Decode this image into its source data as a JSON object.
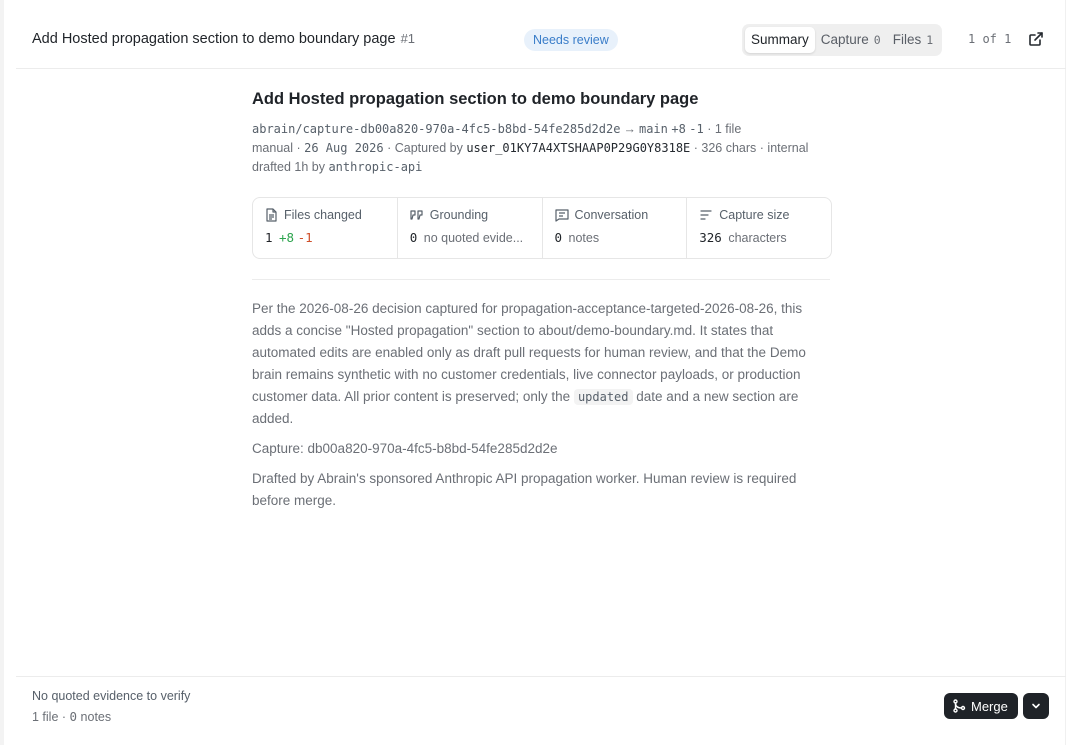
{
  "header": {
    "title": "Add Hosted propagation section to demo boundary page",
    "number": "#1",
    "status": "Needs review",
    "tabs": [
      {
        "label": "Summary",
        "count": ""
      },
      {
        "label": "Capture",
        "count": "0"
      },
      {
        "label": "Files",
        "count": "1"
      }
    ],
    "pager": "1 of 1"
  },
  "main": {
    "title": "Add Hosted propagation section to demo boundary page",
    "branch": "abrain/capture-db00a820-970a-4fc5-b8bd-54fe285d2d2e",
    "arrow": "→",
    "base": "main",
    "additions": "+8",
    "deletions": "-1",
    "files_label": "· 1 file",
    "capture_method": "manual ·",
    "capture_date": "26 Aug 2026",
    "captured_by_label": "· Captured by",
    "captured_by_user": "user_01KY7A4XTSHAAP0P29G0Y8318E",
    "chars_label": "· 326 chars ·",
    "visibility": "internal",
    "drafted_prefix": "drafted 1h by",
    "drafted_by": "anthropic-api"
  },
  "cards": {
    "files": {
      "label": "Files changed",
      "count": "1",
      "additions": "+8",
      "deletions": "-1"
    },
    "grounding": {
      "label": "Grounding",
      "count": "0",
      "text": "no quoted evide..."
    },
    "conversation": {
      "label": "Conversation",
      "count": "0",
      "text": "notes"
    },
    "capture_size": {
      "label": "Capture size",
      "count": "326",
      "text": "characters"
    }
  },
  "body": {
    "p1_before": "Per the 2026-08-26 decision captured for propagation-acceptance-targeted-2026-08-26, this adds a concise \"Hosted propagation\" section to about/demo-boundary.md. It states that automated edits are enabled only as draft pull requests for human review, and that the Demo brain remains synthetic with no customer credentials, live connector payloads, or production customer data. All prior content is preserved; only the",
    "p1_code": "updated",
    "p1_after": "date and a new section are added.",
    "p2": "Capture: db00a820-970a-4fc5-b8bd-54fe285d2d2e",
    "p3": "Drafted by Abrain's sponsored Anthropic API propagation worker. Human review is required before merge."
  },
  "footer": {
    "evidence": "No quoted evidence to verify",
    "files": "1 file ·",
    "notes_count": "0",
    "notes_label": "notes",
    "merge_label": "Merge"
  },
  "icons": {
    "external": "external-link-icon",
    "file": "file-icon",
    "grounding": "quote-icon",
    "conversation": "message-icon",
    "capture_size": "lines-icon",
    "merge": "git-merge-icon",
    "dropdown": "chevron-down-icon"
  },
  "colors": {
    "badge_bg": "#e8f1fb",
    "badge_text": "#3a7dc9",
    "additions": "#2da44e",
    "deletions": "#cf4f2a",
    "merge_button": "#1f2328"
  }
}
